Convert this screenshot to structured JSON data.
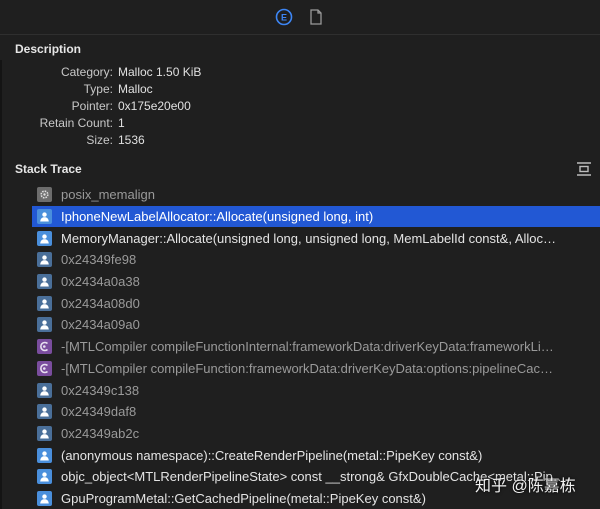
{
  "tabs": [
    {
      "icon": "info-circle-icon",
      "active": true
    },
    {
      "icon": "document-icon",
      "active": false
    }
  ],
  "description": {
    "title": "Description",
    "fields": [
      {
        "key": "Category:",
        "value": "Malloc 1.50 KiB"
      },
      {
        "key": "Type:",
        "value": "Malloc"
      },
      {
        "key": "Pointer:",
        "value": "0x175e20e00"
      },
      {
        "key": "Retain Count:",
        "value": "1"
      },
      {
        "key": "Size:",
        "value": "1536"
      }
    ]
  },
  "stack_trace": {
    "title": "Stack Trace",
    "frames": [
      {
        "label": "posix_memalign",
        "kind": "system",
        "dim": true
      },
      {
        "label": "IphoneNewLabelAllocator::Allocate(unsigned long, int)",
        "kind": "user",
        "dim": false,
        "selected": true
      },
      {
        "label": "MemoryManager::Allocate(unsigned long, unsigned long, MemLabelId const&, Alloc…",
        "kind": "user",
        "dim": false
      },
      {
        "label": "0x24349fe98",
        "kind": "user",
        "dim": true
      },
      {
        "label": "0x2434a0a38",
        "kind": "user",
        "dim": true
      },
      {
        "label": "0x2434a08d0",
        "kind": "user",
        "dim": true
      },
      {
        "label": "0x2434a09a0",
        "kind": "user",
        "dim": true
      },
      {
        "label": "-[MTLCompiler compileFunctionInternal:frameworkData:driverKeyData:frameworkLi…",
        "kind": "objc",
        "dim": true
      },
      {
        "label": "-[MTLCompiler compileFunction:frameworkData:driverKeyData:options:pipelineCac…",
        "kind": "objc",
        "dim": true
      },
      {
        "label": "0x24349c138",
        "kind": "user",
        "dim": true
      },
      {
        "label": "0x24349daf8",
        "kind": "user",
        "dim": true
      },
      {
        "label": "0x24349ab2c",
        "kind": "user",
        "dim": true
      },
      {
        "label": "(anonymous namespace)::CreateRenderPipeline(metal::PipeKey const&)",
        "kind": "user",
        "dim": false
      },
      {
        "label": "objc_object<MTLRenderPipelineState> const __strong& GfxDoubleCache<metal::Pip…",
        "kind": "user",
        "dim": false
      },
      {
        "label": "GpuProgramMetal::GetCachedPipeline(metal::PipeKey const&)",
        "kind": "user",
        "dim": false
      }
    ]
  },
  "watermark": "知乎 @陈嘉栋",
  "colors": {
    "selection": "#2258d4",
    "user_icon": "#4a8fdc",
    "objc_icon": "#7a4d9e",
    "background": "#1f1f1f"
  }
}
